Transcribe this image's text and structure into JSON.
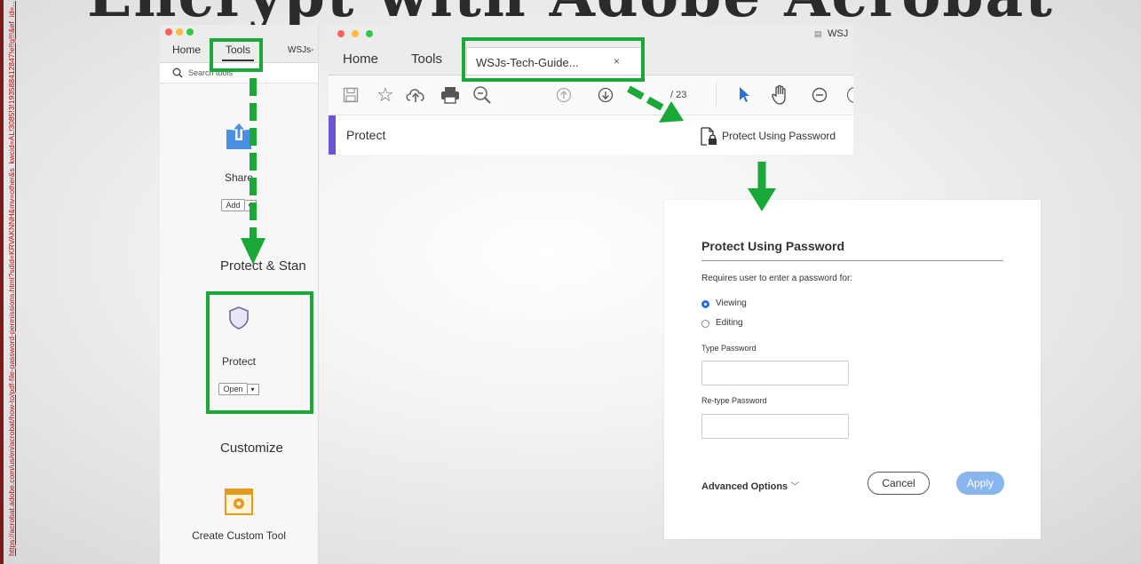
{
  "slide": {
    "title": "Encrypt with Adobe Acrobat",
    "source_link": "https://acrobat.adobe.com/us/en/acrobat/how-to/pdf-file-password-permissions.html?sdid=KRVAKNNH&mv=other&s_kwcid=AL!3085!3!193588412847!e!!g!!!&ef_id=…"
  },
  "left_window": {
    "tabs": [
      "Home",
      "Tools",
      "WSJs-"
    ],
    "search_placeholder": "Search tools",
    "tools": [
      {
        "label": "Share",
        "button": "Add"
      },
      {
        "label": "Protect",
        "button": "Open"
      },
      {
        "label": "Create Custom Tool"
      }
    ],
    "sections": [
      "Protect & Stan",
      "Customize"
    ]
  },
  "main_window": {
    "window_title": "WSJ",
    "tabs": {
      "home": "Home",
      "tools": "Tools",
      "doc": "WSJs-Tech-Guide...",
      "close": "×"
    },
    "page_total": "/ 23",
    "protect_label": "Protect",
    "protect_using_password": "Protect Using Password"
  },
  "dialog": {
    "title": "Protect Using Password",
    "requires_text": "Requires user to enter a password for:",
    "options": [
      {
        "label": "Viewing",
        "selected": true
      },
      {
        "label": "Editing",
        "selected": false
      }
    ],
    "type_password_label": "Type Password",
    "retype_password_label": "Re-type Password",
    "advanced_options": "Advanced Options",
    "cancel": "Cancel",
    "apply": "Apply"
  },
  "colors": {
    "highlight_green": "#1aa838",
    "accent_blue": "#2c6fd6",
    "apply_blue": "#8ab6ef",
    "protect_bar": "#6b57d6"
  }
}
